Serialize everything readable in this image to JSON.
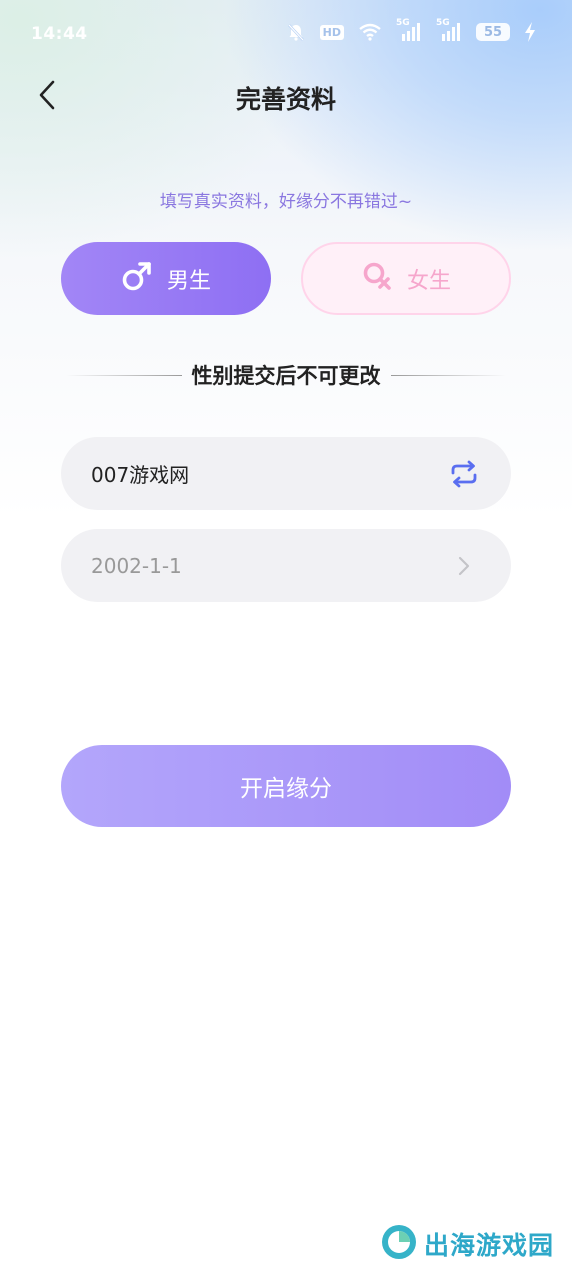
{
  "status_bar": {
    "time": "14:44",
    "hd_label": "HD",
    "network_label_1": "5G",
    "network_label_2": "5G",
    "battery_level": "55",
    "icons": [
      "bell-off-icon",
      "hd-icon",
      "wifi-icon",
      "signal-5g-icon",
      "signal-5g-icon",
      "battery-icon",
      "charging-icon"
    ]
  },
  "nav": {
    "title": "完善资料",
    "back_icon": "chevron-left-icon"
  },
  "subtitle": "填写真实资料，好缘分不再错过~",
  "gender": {
    "male_label": "男生",
    "female_label": "女生",
    "selected": "male",
    "male_icon": "male-symbol-icon",
    "female_icon": "female-symbol-icon"
  },
  "notice": "性别提交后不可更改",
  "form": {
    "nickname_value": "007游戏网",
    "nickname_icon": "refresh-icon",
    "birthday_value": "2002-1-1",
    "birthday_icon": "chevron-right-icon"
  },
  "submit_label": "开启缘分",
  "watermark": "出海游戏园",
  "colors": {
    "accent": "#9175f4",
    "subtitle": "#8a77e0",
    "female_text": "#f6a6cc",
    "female_bg": "#fff0f8",
    "field_bg": "#f1f1f4",
    "refresh_icon": "#5a6ef0"
  }
}
